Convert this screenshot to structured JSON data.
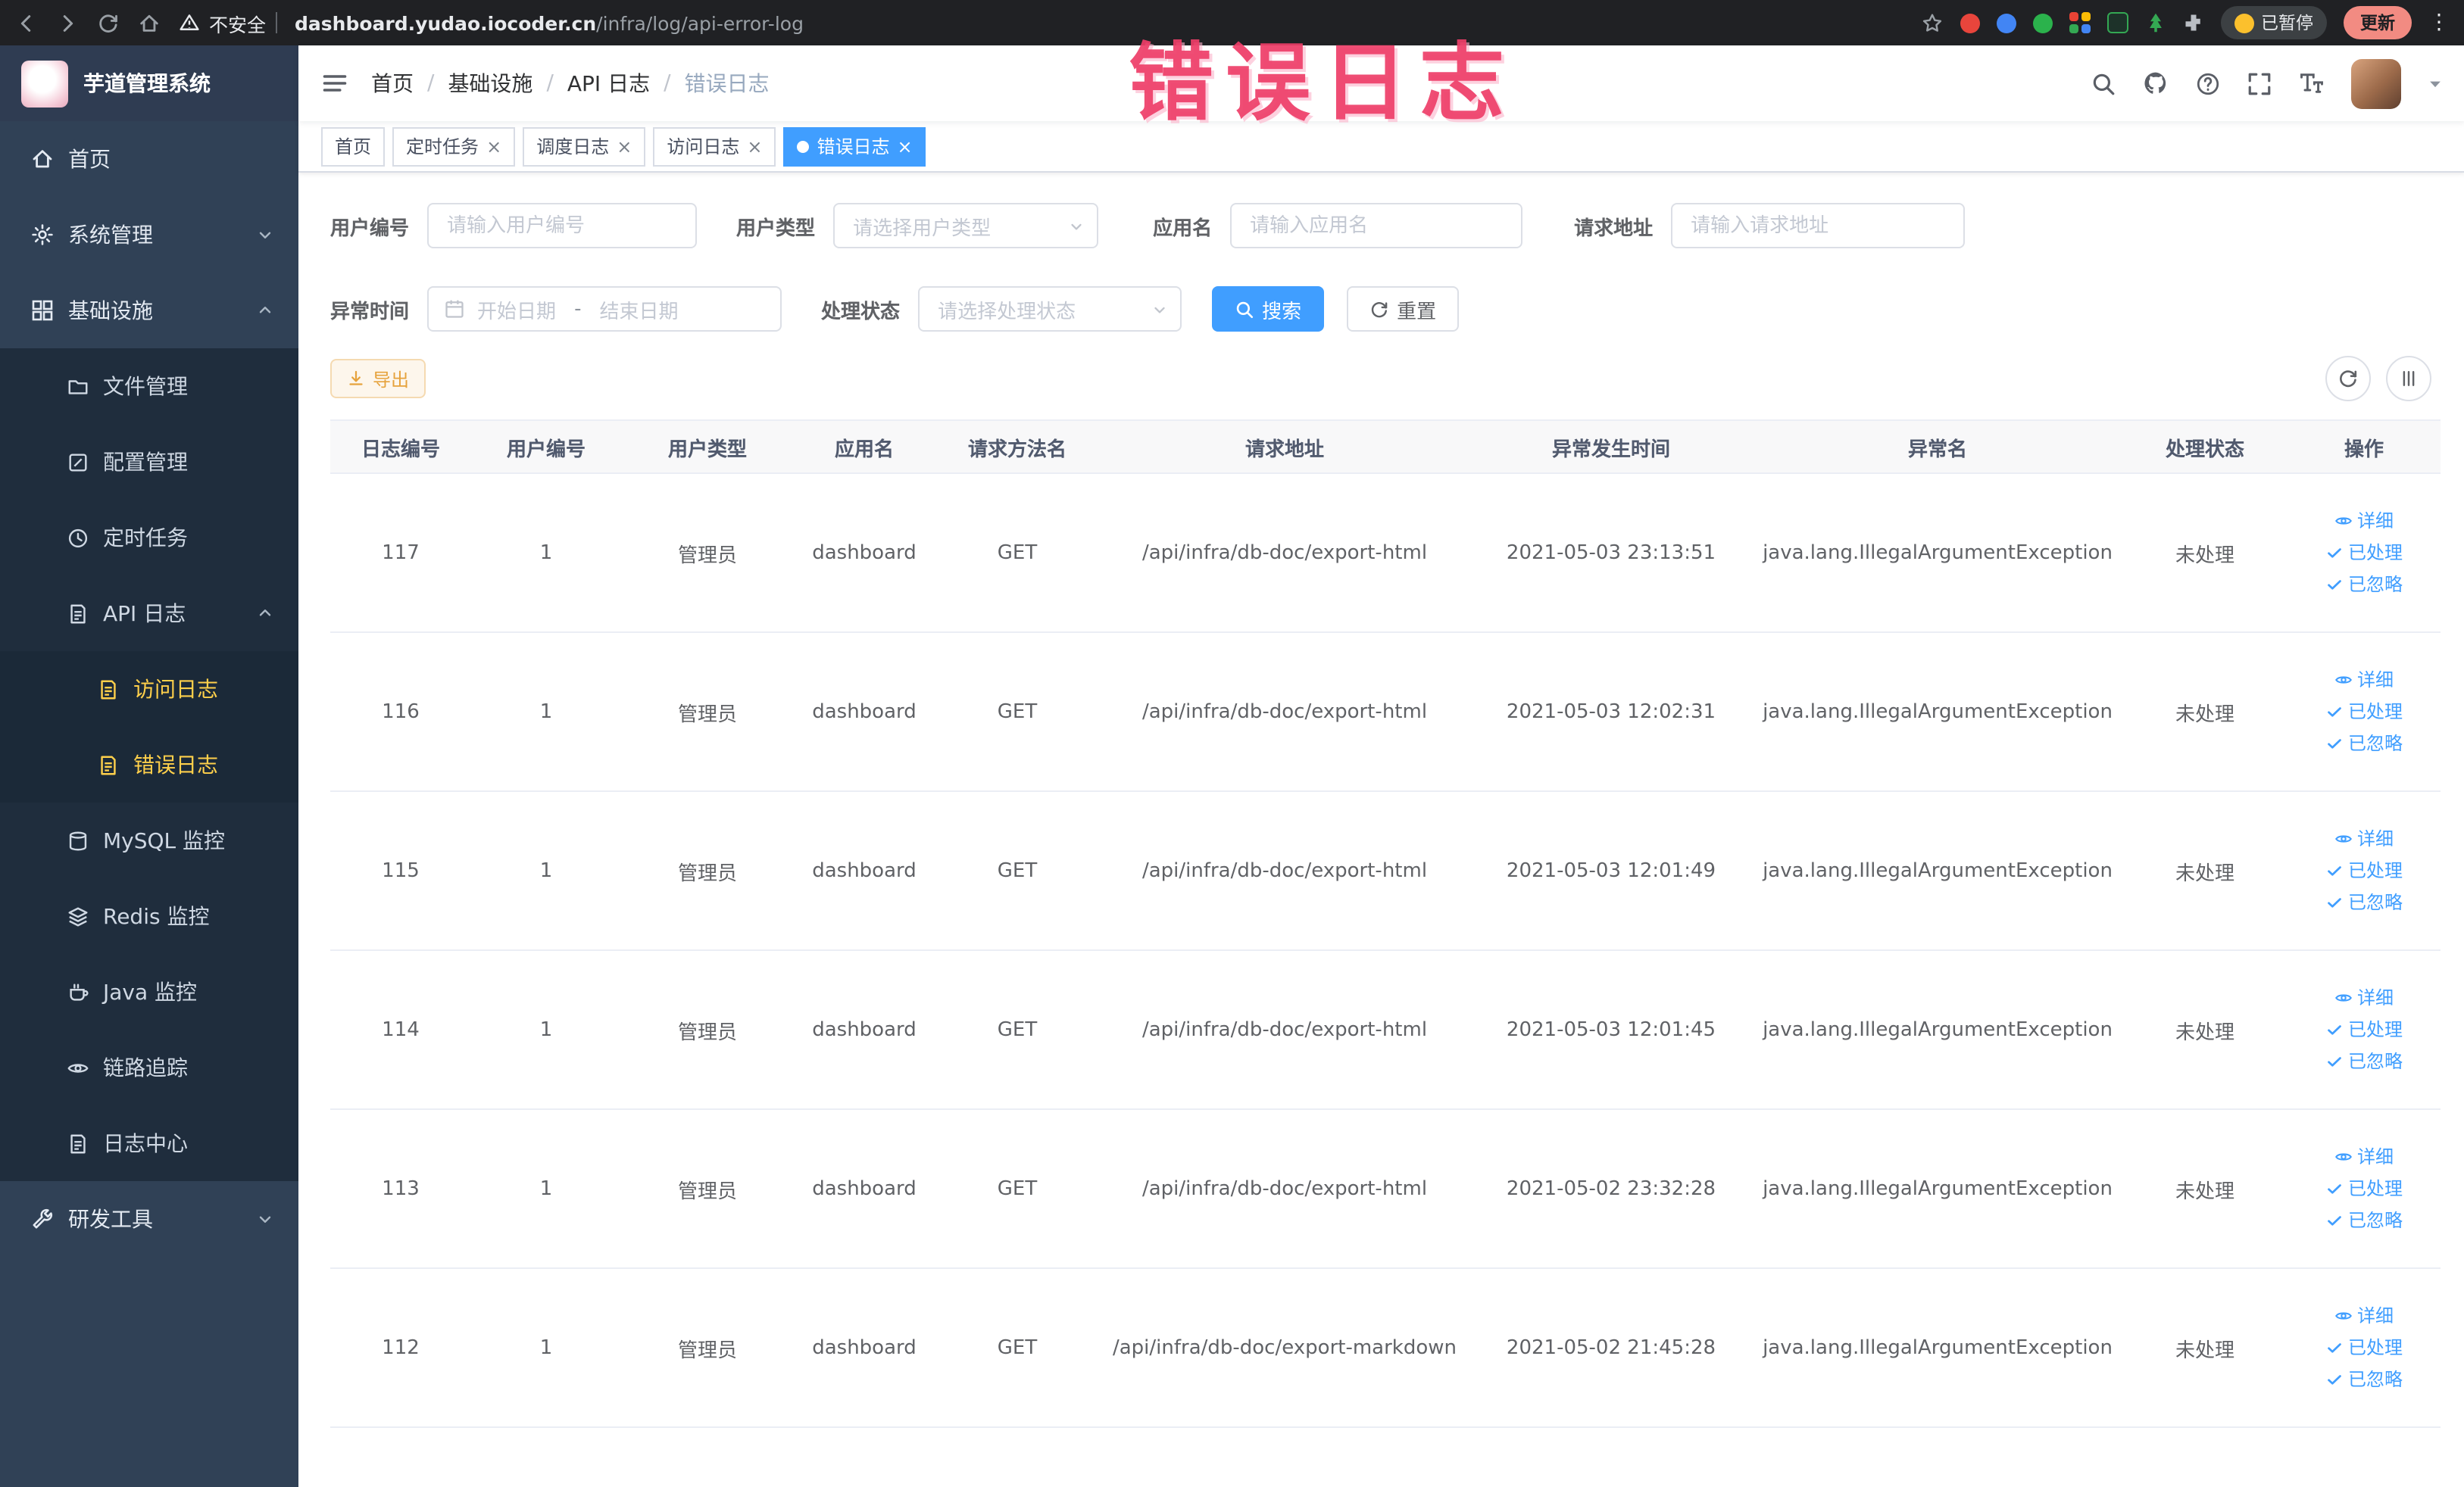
{
  "colors": {
    "primary": "#409eff",
    "warning": "#e6a23c",
    "sidebar_bg": "#304156",
    "submenu_bg": "#1f2d3d",
    "active_menu_text": "#ffd04b",
    "annotation": "#ee3e68"
  },
  "annotation": {
    "text": "错误日志"
  },
  "browser": {
    "security_label": "不安全",
    "url_host": "dashboard.yudao.iocoder.cn",
    "url_path": "/infra/log/api-error-log",
    "paused_badge": "已暂停",
    "update_button": "更新"
  },
  "sidebar": {
    "logo_title": "芋道管理系统",
    "home": "首页",
    "system_mgmt": "系统管理",
    "infrastructure": "基础设施",
    "file_mgmt": "文件管理",
    "config_mgmt": "配置管理",
    "job": "定时任务",
    "api_log": "API 日志",
    "access_log": "访问日志",
    "error_log": "错误日志",
    "mysql": "MySQL 监控",
    "redis": "Redis 监控",
    "java": "Java 监控",
    "trace": "链路追踪",
    "log_center": "日志中心",
    "dev_tools": "研发工具"
  },
  "breadcrumb": {
    "items": [
      "首页",
      "基础设施",
      "API 日志",
      "错误日志"
    ]
  },
  "tabs": [
    {
      "label": "首页"
    },
    {
      "label": "定时任务"
    },
    {
      "label": "调度日志"
    },
    {
      "label": "访问日志"
    },
    {
      "label": "错误日志"
    }
  ],
  "filters": {
    "user_no": {
      "label": "用户编号",
      "placeholder": "请输入用户编号"
    },
    "user_type": {
      "label": "用户类型",
      "placeholder": "请选择用户类型"
    },
    "app_name": {
      "label": "应用名",
      "placeholder": "请输入应用名"
    },
    "request_url": {
      "label": "请求地址",
      "placeholder": "请输入请求地址"
    },
    "exception_time": {
      "label": "异常时间",
      "start_placeholder": "开始日期",
      "separator": "-",
      "end_placeholder": "结束日期"
    },
    "process_status": {
      "label": "处理状态",
      "placeholder": "请选择处理状态"
    },
    "search": "搜索",
    "reset": "重置"
  },
  "toolbar": {
    "export": "导出"
  },
  "table": {
    "columns": [
      "日志编号",
      "用户编号",
      "用户类型",
      "应用名",
      "请求方法名",
      "请求地址",
      "异常发生时间",
      "异常名",
      "处理状态",
      "操作"
    ],
    "actions": {
      "detail": "详细",
      "processed": "已处理",
      "ignored": "已忽略"
    },
    "rows": [
      {
        "id": "117",
        "user_id": "1",
        "user_type": "管理员",
        "app": "dashboard",
        "method": "GET",
        "url": "/api/infra/db-doc/export-html",
        "time": "2021-05-03 23:13:51",
        "exception": "java.lang.IllegalArgumentException",
        "status": "未处理"
      },
      {
        "id": "116",
        "user_id": "1",
        "user_type": "管理员",
        "app": "dashboard",
        "method": "GET",
        "url": "/api/infra/db-doc/export-html",
        "time": "2021-05-03 12:02:31",
        "exception": "java.lang.IllegalArgumentException",
        "status": "未处理"
      },
      {
        "id": "115",
        "user_id": "1",
        "user_type": "管理员",
        "app": "dashboard",
        "method": "GET",
        "url": "/api/infra/db-doc/export-html",
        "time": "2021-05-03 12:01:49",
        "exception": "java.lang.IllegalArgumentException",
        "status": "未处理"
      },
      {
        "id": "114",
        "user_id": "1",
        "user_type": "管理员",
        "app": "dashboard",
        "method": "GET",
        "url": "/api/infra/db-doc/export-html",
        "time": "2021-05-03 12:01:45",
        "exception": "java.lang.IllegalArgumentException",
        "status": "未处理"
      },
      {
        "id": "113",
        "user_id": "1",
        "user_type": "管理员",
        "app": "dashboard",
        "method": "GET",
        "url": "/api/infra/db-doc/export-html",
        "time": "2021-05-02 23:32:28",
        "exception": "java.lang.IllegalArgumentException",
        "status": "未处理"
      },
      {
        "id": "112",
        "user_id": "1",
        "user_type": "管理员",
        "app": "dashboard",
        "method": "GET",
        "url": "/api/infra/db-doc/export-markdown",
        "time": "2021-05-02 21:45:28",
        "exception": "java.lang.IllegalArgumentException",
        "status": "未处理"
      }
    ]
  }
}
